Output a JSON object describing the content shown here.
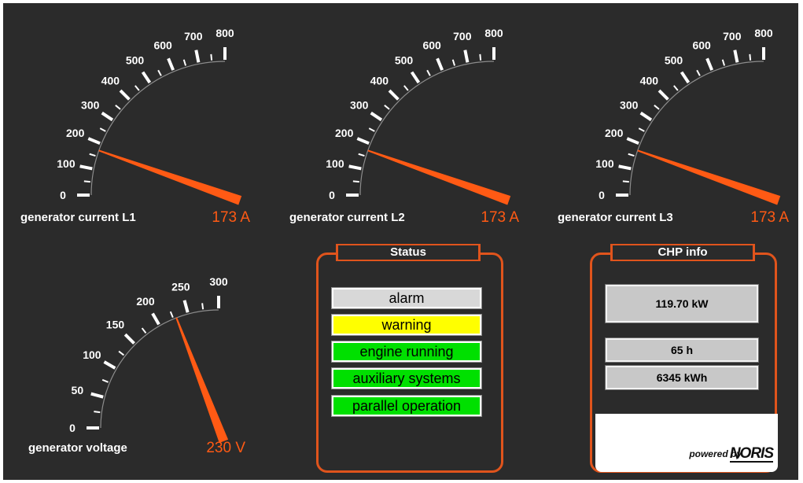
{
  "gauges": [
    {
      "id": "l1",
      "label": "generator current L1",
      "value": 173,
      "value_text": "173 A",
      "min": 0,
      "max": 800,
      "ticks": [
        "0",
        "100",
        "200",
        "300",
        "400",
        "500",
        "600",
        "700",
        "800"
      ]
    },
    {
      "id": "l2",
      "label": "generator current L2",
      "value": 173,
      "value_text": "173 A",
      "min": 0,
      "max": 800,
      "ticks": [
        "0",
        "100",
        "200",
        "300",
        "400",
        "500",
        "600",
        "700",
        "800"
      ]
    },
    {
      "id": "l3",
      "label": "generator current L3",
      "value": 173,
      "value_text": "173 A",
      "min": 0,
      "max": 800,
      "ticks": [
        "0",
        "100",
        "200",
        "300",
        "400",
        "500",
        "600",
        "700",
        "800"
      ]
    },
    {
      "id": "volt",
      "label": "generator voltage",
      "value": 230,
      "value_text": "230 V",
      "min": 0,
      "max": 300,
      "ticks": [
        "0",
        "50",
        "100",
        "150",
        "200",
        "250",
        "300"
      ]
    }
  ],
  "status": {
    "title": "Status",
    "items": [
      {
        "label": "alarm",
        "color": "#d8d8d8"
      },
      {
        "label": "warning",
        "color": "#ffff00"
      },
      {
        "label": "engine running",
        "color": "#00e000"
      },
      {
        "label": "auxiliary systems",
        "color": "#00e000"
      },
      {
        "label": "parallel operation",
        "color": "#00e000"
      }
    ]
  },
  "chp_info": {
    "title": "CHP info",
    "power": "119.70 kW",
    "hours": "65 h",
    "energy": "6345 kWh"
  },
  "branding": {
    "powered_by": "powered by",
    "logo": "NORIS"
  },
  "colors": {
    "background": "#2b2b2b",
    "accent": "#ff5a14",
    "frame": "#e0541c"
  }
}
